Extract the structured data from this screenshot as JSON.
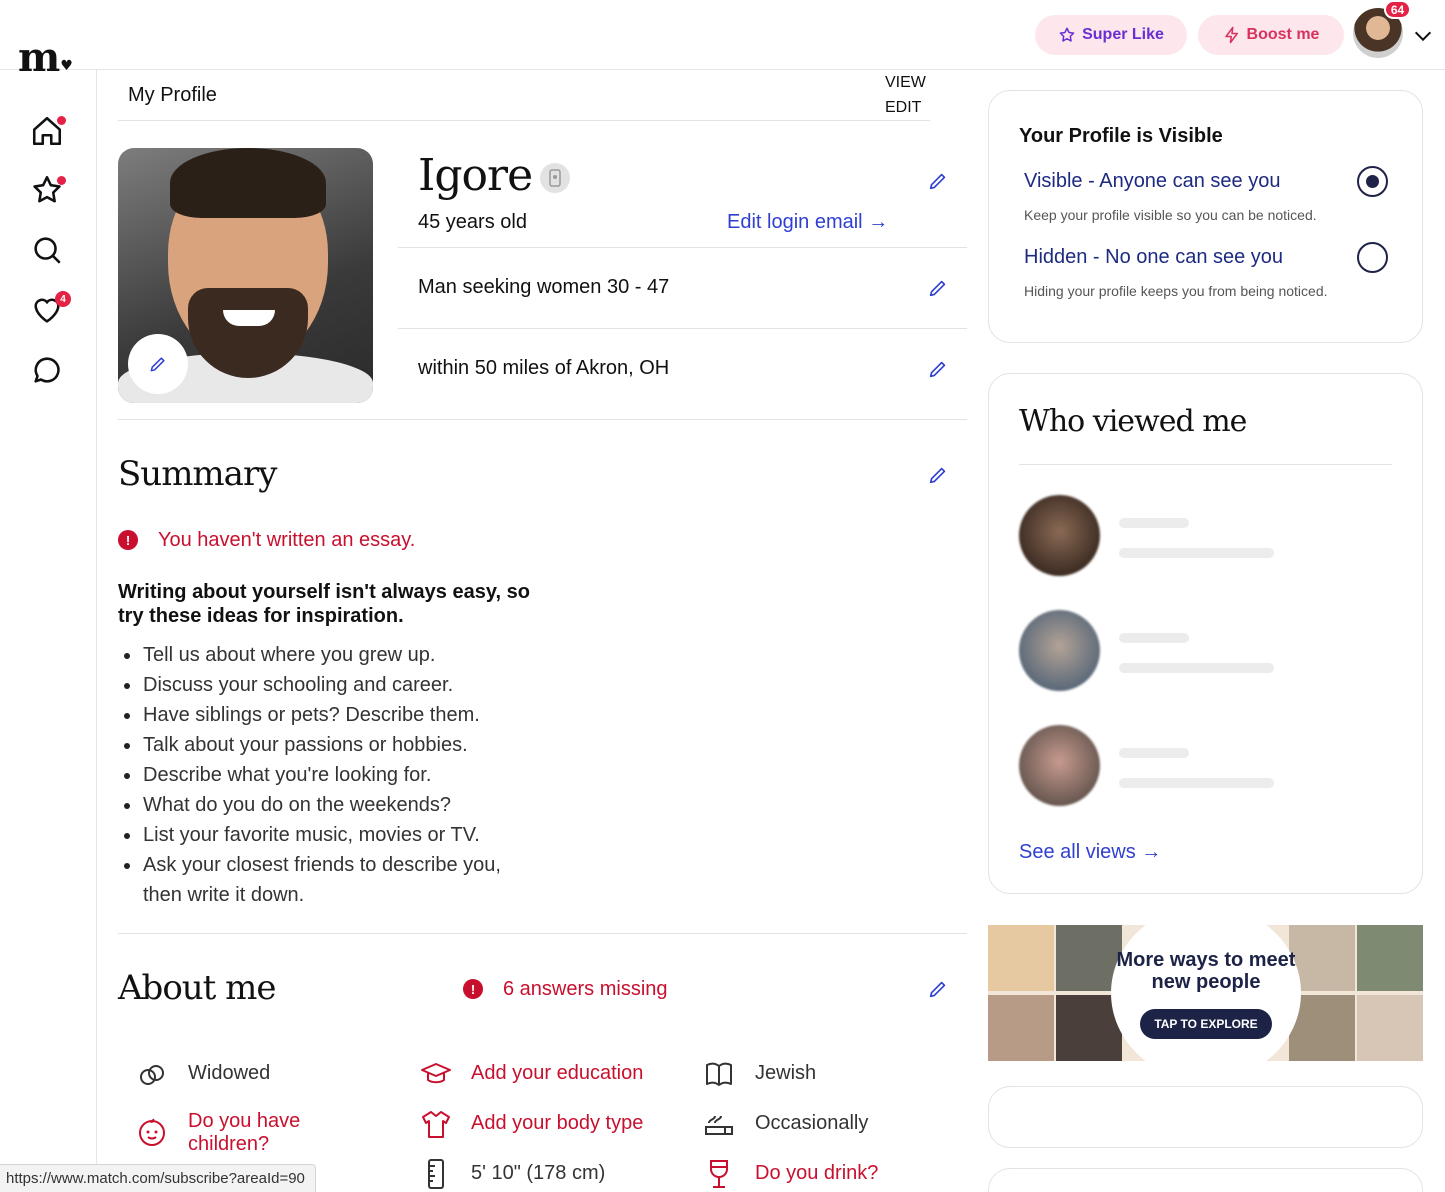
{
  "brand": {
    "logo": "m.",
    "accent": "#c8102e",
    "link": "#2f3fd1"
  },
  "topbar": {
    "super_like": "Super Like",
    "boost": "Boost me",
    "notification_count": "64"
  },
  "sidenav": {
    "items": [
      {
        "icon": "home-icon",
        "dot": true
      },
      {
        "icon": "star-icon",
        "dot": true
      },
      {
        "icon": "search-icon",
        "dot": false
      },
      {
        "icon": "heart-icon",
        "badge": "4"
      },
      {
        "icon": "chat-icon",
        "dot": false
      }
    ]
  },
  "profile": {
    "title": "My Profile",
    "view": "VIEW",
    "edit": "EDIT",
    "name": "Igore",
    "age": "45 years old",
    "edit_login_email": "Edit login email",
    "seeking": "Man seeking women 30 - 47",
    "location": "within 50 miles of Akron, OH"
  },
  "summary": {
    "title": "Summary",
    "alert": "You haven't written an essay.",
    "ideas_heading": "Writing about yourself isn't always easy, so try these ideas for inspiration.",
    "ideas": [
      "Tell us about where you grew up.",
      "Discuss your schooling and career.",
      "Have siblings or pets? Describe them.",
      "Talk about your passions or hobbies.",
      "Describe what you're looking for.",
      "What do you do on the weekends?",
      "List your favorite music, movies or TV.",
      "Ask your closest friends to describe you, then write it down."
    ]
  },
  "about": {
    "title": "About me",
    "missing": "6 answers missing",
    "attributes": [
      {
        "icon": "rings-icon",
        "text": "Widowed",
        "missing": false
      },
      {
        "icon": "graduation-cap-icon",
        "text": "Add your education",
        "missing": true
      },
      {
        "icon": "book-icon",
        "text": "Jewish",
        "missing": false
      },
      {
        "icon": "baby-face-icon",
        "text": "Do you have children?",
        "missing": true
      },
      {
        "icon": "shirt-icon",
        "text": "Add your body type",
        "missing": true
      },
      {
        "icon": "smoke-icon",
        "text": "Occasionally",
        "missing": false
      },
      {
        "icon": "ruler-icon",
        "text": "5' 10\" (178 cm)",
        "missing": false
      },
      {
        "icon": "wine-glass-icon",
        "text": "Do you drink?",
        "missing": true
      }
    ]
  },
  "visibility": {
    "title": "Your Profile is Visible",
    "visible_label": "Visible - Anyone can see you",
    "visible_desc": "Keep your profile visible so you can be noticed.",
    "hidden_label": "Hidden - No one can see you",
    "hidden_desc": "Hiding your profile keeps you from being noticed.",
    "selected": "visible"
  },
  "views": {
    "title": "Who viewed me",
    "see_all": "See all views"
  },
  "promo": {
    "headline": "More ways to meet new people",
    "cta": "TAP TO EXPLORE"
  },
  "status_bar": {
    "url": "https://www.match.com/subscribe?areaId=90"
  }
}
